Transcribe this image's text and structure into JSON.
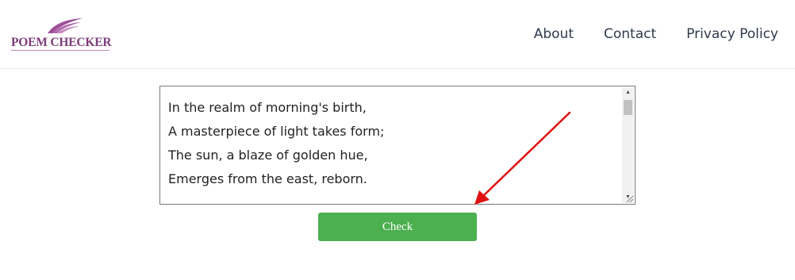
{
  "header": {
    "logo_text": "POEM CHECKER",
    "nav": [
      {
        "label": "About"
      },
      {
        "label": "Contact"
      },
      {
        "label": "Privacy Policy"
      }
    ]
  },
  "editor": {
    "value": "In the realm of morning's birth,\nA masterpiece of light takes form;\nThe sun, a blaze of golden hue,\nEmerges from the east, reborn."
  },
  "check_button": {
    "label": "Check"
  },
  "colors": {
    "brand": "#7d3c7a",
    "button": "#4caf50",
    "annotation_arrow": "#e01010"
  },
  "icons": {
    "logo": "wing-icon",
    "annotation": "red-arrow-icon"
  }
}
